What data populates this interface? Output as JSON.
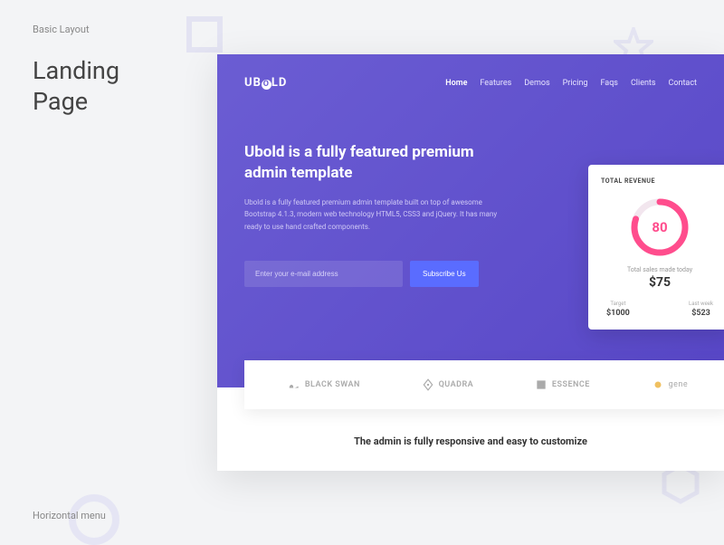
{
  "meta": {
    "label_top": "Basic Layout",
    "title_l1": "Landing",
    "title_l2": "Page",
    "label_bottom": "Horizontal menu"
  },
  "logo": {
    "pre": "UB",
    "mid": "O",
    "post": "LD"
  },
  "nav": [
    "Home",
    "Features",
    "Demos",
    "Pricing",
    "Faqs",
    "Clients",
    "Contact"
  ],
  "hero": {
    "heading": "Ubold is a fully featured premium admin template",
    "sub": "Ubold is a fully featured premium admin template built on top of awesome Bootstrap 4.1.3, modern web technology HTML5, CSS3 and jQuery. It has many ready to use hand crafted components.",
    "email_placeholder": "Enter your e-mail address",
    "subscribe": "Subscribe Us"
  },
  "card": {
    "title": "TOTAL REVENUE",
    "pct": "80",
    "sub1": "Total sales made today",
    "amount": "$75",
    "target_l": "Target",
    "target_v": "$1000",
    "last_l": "Last week",
    "last_v": "$523"
  },
  "clients": {
    "c1": "BLACK SWAN",
    "c2": "QUADRA",
    "c3": "ESSENCE",
    "c4": "gene"
  },
  "tagline": "The admin is fully responsive and easy to customize"
}
